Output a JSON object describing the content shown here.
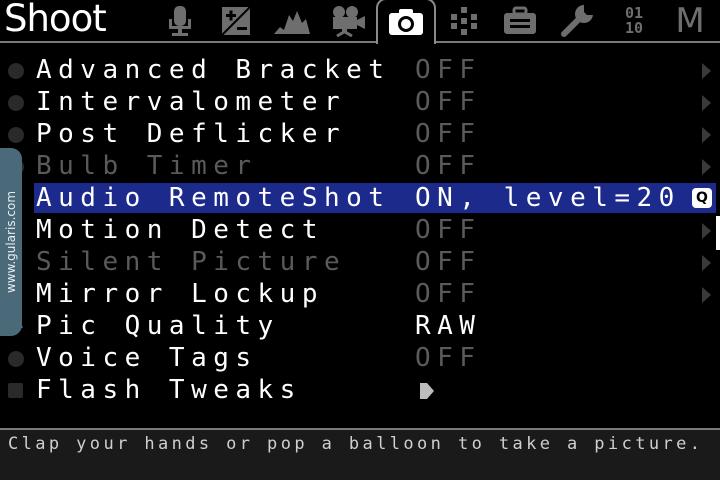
{
  "header": {
    "title": "Shoot",
    "tabs": [
      {
        "name": "audio",
        "icon": "microphone-icon",
        "active": false
      },
      {
        "name": "expo",
        "icon": "exposure-icon",
        "active": false
      },
      {
        "name": "overlay",
        "icon": "histogram-icon",
        "active": false
      },
      {
        "name": "movie",
        "icon": "movie-camera-icon",
        "active": false
      },
      {
        "name": "shoot",
        "icon": "camera-icon",
        "active": true
      },
      {
        "name": "focus",
        "icon": "focus-points-icon",
        "active": false
      },
      {
        "name": "display",
        "icon": "briefcase-icon",
        "active": false
      },
      {
        "name": "tweaks",
        "icon": "wrench-icon",
        "active": false
      },
      {
        "name": "debug",
        "icon": "binary-icon",
        "active": false,
        "text": "01\n10"
      },
      {
        "name": "my-menu",
        "icon": "m-icon",
        "active": false,
        "text": "M"
      }
    ]
  },
  "menu": {
    "items": [
      {
        "label": "Advanced Bracket",
        "value": "OFF",
        "enabled": true
      },
      {
        "label": "Intervalometer",
        "value": "OFF",
        "enabled": true
      },
      {
        "label": "Post Deflicker",
        "value": "OFF",
        "enabled": true
      },
      {
        "label": "Bulb Timer",
        "value": "OFF",
        "enabled": false
      },
      {
        "label": "Audio RemoteShot",
        "value": "ON, level=20",
        "enabled": true,
        "selected": true
      },
      {
        "label": "Motion Detect",
        "value": "OFF",
        "enabled": true
      },
      {
        "label": "Silent Picture",
        "value": "OFF",
        "enabled": false
      },
      {
        "label": "Mirror Lockup",
        "value": "OFF",
        "enabled": true
      },
      {
        "label": "Pic Quality",
        "value": "RAW",
        "enabled": true
      },
      {
        "label": "Voice Tags",
        "value": "OFF",
        "enabled": true
      },
      {
        "label": "Flash Tweaks",
        "value": "",
        "enabled": true
      }
    ],
    "q_badge": "Q"
  },
  "watermark": "www.gularis.com",
  "help_text": "Clap your hands or pop a balloon to take a picture.",
  "colors": {
    "highlight": "#1c2a8c",
    "dim_text": "#5a5a5a",
    "background": "#000000"
  }
}
